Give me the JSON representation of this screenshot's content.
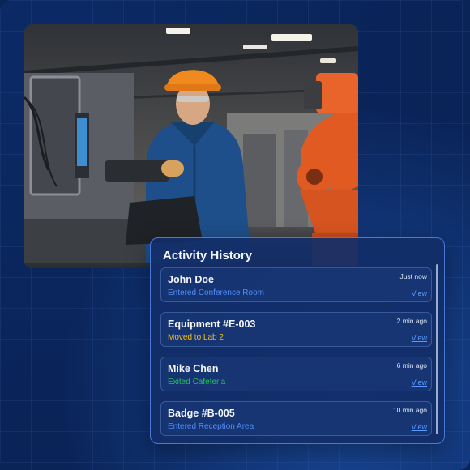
{
  "panel": {
    "title": "Activity History"
  },
  "activities": [
    {
      "name": "John Doe",
      "time": "Just now",
      "status": "Entered Conference Room",
      "status_color": "#4f8ef7",
      "action": "View"
    },
    {
      "name": "Equipment #E-003",
      "time": "2 min ago",
      "status": "Moved to Lab 2",
      "status_color": "#f3c01b",
      "action": "View"
    },
    {
      "name": "Mike Chen",
      "time": "6 min ago",
      "status": "Exited Cafeteria",
      "status_color": "#21c25a",
      "action": "View"
    },
    {
      "name": "Badge #B-005",
      "time": "10 min ago",
      "status": "Entered Reception Area",
      "status_color": "#4f8ef7",
      "action": "View"
    }
  ],
  "colors": {
    "background": "#0a2458",
    "panel_border": "#4a78d6",
    "link": "#5b9bff"
  }
}
